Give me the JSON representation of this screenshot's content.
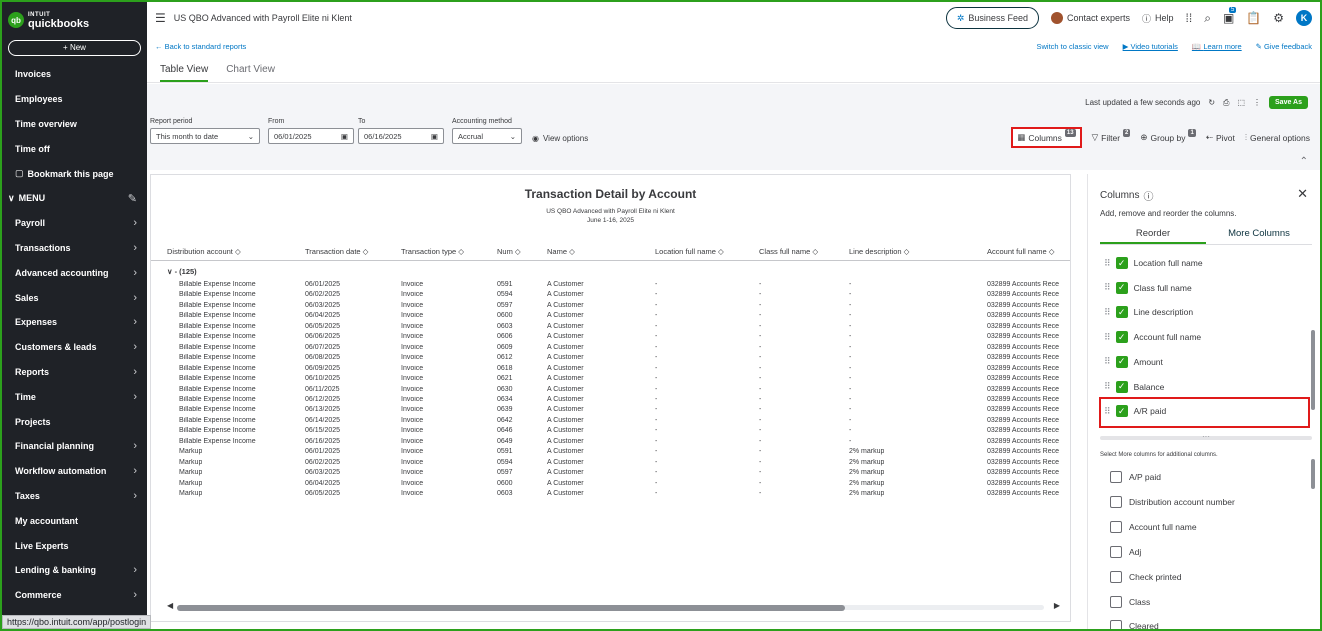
{
  "sidebar": {
    "logo_top": "INTUIT",
    "logo_bottom": "quickbooks",
    "logo_badge": "qb",
    "new_label": "+ New",
    "items": [
      {
        "label": "Invoices",
        "chevron": false
      },
      {
        "label": "Employees",
        "chevron": false
      },
      {
        "label": "Time overview",
        "chevron": false
      },
      {
        "label": "Time off",
        "chevron": false
      },
      {
        "label": "Bookmark this page",
        "chevron": false,
        "icon": "bookmark-icon"
      },
      {
        "label": "MENU",
        "chevron": false,
        "menu": true
      },
      {
        "label": "Payroll",
        "chevron": true
      },
      {
        "label": "Transactions",
        "chevron": true
      },
      {
        "label": "Advanced accounting",
        "chevron": true
      },
      {
        "label": "Sales",
        "chevron": true
      },
      {
        "label": "Expenses",
        "chevron": true
      },
      {
        "label": "Customers & leads",
        "chevron": true
      },
      {
        "label": "Reports",
        "chevron": true
      },
      {
        "label": "Time",
        "chevron": true
      },
      {
        "label": "Projects",
        "chevron": false
      },
      {
        "label": "Financial planning",
        "chevron": true
      },
      {
        "label": "Workflow automation",
        "chevron": true
      },
      {
        "label": "Taxes",
        "chevron": true
      },
      {
        "label": "My accountant",
        "chevron": false
      },
      {
        "label": "Live Experts",
        "chevron": false
      },
      {
        "label": "Lending & banking",
        "chevron": true
      },
      {
        "label": "Commerce",
        "chevron": true
      }
    ],
    "status_url": "https://qbo.intuit.com/app/postlogin"
  },
  "topbar": {
    "company": "US QBO Advanced with Payroll Elite ni Klent",
    "business_feed": "Business Feed",
    "contact_experts": "Contact experts",
    "help": "Help",
    "avatar_letter": "K",
    "notification_count": "5"
  },
  "subbar": {
    "back": "← Back to standard reports",
    "switch_classic": "Switch to classic view",
    "video_tutorials": "Video tutorials",
    "learn_more": "Learn more",
    "give_feedback": "Give feedback"
  },
  "tabs": [
    "Table View",
    "Chart View"
  ],
  "filters": {
    "last_updated": "Last updated a few seconds ago",
    "save_label": "Save As",
    "report_period_label": "Report period",
    "report_period_value": "This month to date",
    "from_label": "From",
    "from_value": "06/01/2025",
    "to_label": "To",
    "to_value": "06/16/2025",
    "method_label": "Accounting method",
    "method_value": "Accrual",
    "view_options": "View options",
    "columns_label": "Columns",
    "columns_count": "13",
    "filter_label": "Filter",
    "filter_count": "2",
    "groupby_label": "Group by",
    "groupby_count": "1",
    "pivot_label": "Pivot",
    "general_options": "General options"
  },
  "report": {
    "title": "Transaction Detail by Account",
    "subtitle": "US QBO Advanced with Payroll Elite ni Klent",
    "date_range": "June 1-16, 2025",
    "headers": [
      "Distribution account ◇",
      "Transaction date ◇",
      "Transaction type ◇",
      "Num ◇",
      "Name ◇",
      "Location full name ◇",
      "Class full name ◇",
      "Line description ◇",
      "Account full name ◇"
    ],
    "group_label": "∨  - (125)",
    "rows": [
      [
        "Billable Expense Income",
        "06/01/2025",
        "Invoice",
        "0591",
        "A Customer",
        "-",
        "-",
        "-",
        "032899 Accounts Rece"
      ],
      [
        "Billable Expense Income",
        "06/02/2025",
        "Invoice",
        "0594",
        "A Customer",
        "-",
        "-",
        "-",
        "032899 Accounts Rece"
      ],
      [
        "Billable Expense Income",
        "06/03/2025",
        "Invoice",
        "0597",
        "A Customer",
        "-",
        "-",
        "-",
        "032899 Accounts Rece"
      ],
      [
        "Billable Expense Income",
        "06/04/2025",
        "Invoice",
        "0600",
        "A Customer",
        "-",
        "-",
        "-",
        "032899 Accounts Rece"
      ],
      [
        "Billable Expense Income",
        "06/05/2025",
        "Invoice",
        "0603",
        "A Customer",
        "-",
        "-",
        "-",
        "032899 Accounts Rece"
      ],
      [
        "Billable Expense Income",
        "06/06/2025",
        "Invoice",
        "0606",
        "A Customer",
        "-",
        "-",
        "-",
        "032899 Accounts Rece"
      ],
      [
        "Billable Expense Income",
        "06/07/2025",
        "Invoice",
        "0609",
        "A Customer",
        "-",
        "-",
        "-",
        "032899 Accounts Rece"
      ],
      [
        "Billable Expense Income",
        "06/08/2025",
        "Invoice",
        "0612",
        "A Customer",
        "-",
        "-",
        "-",
        "032899 Accounts Rece"
      ],
      [
        "Billable Expense Income",
        "06/09/2025",
        "Invoice",
        "0618",
        "A Customer",
        "-",
        "-",
        "-",
        "032899 Accounts Rece"
      ],
      [
        "Billable Expense Income",
        "06/10/2025",
        "Invoice",
        "0621",
        "A Customer",
        "-",
        "-",
        "-",
        "032899 Accounts Rece"
      ],
      [
        "Billable Expense Income",
        "06/11/2025",
        "Invoice",
        "0630",
        "A Customer",
        "-",
        "-",
        "-",
        "032899 Accounts Rece"
      ],
      [
        "Billable Expense Income",
        "06/12/2025",
        "Invoice",
        "0634",
        "A Customer",
        "-",
        "-",
        "-",
        "032899 Accounts Rece"
      ],
      [
        "Billable Expense Income",
        "06/13/2025",
        "Invoice",
        "0639",
        "A Customer",
        "-",
        "-",
        "-",
        "032899 Accounts Rece"
      ],
      [
        "Billable Expense Income",
        "06/14/2025",
        "Invoice",
        "0642",
        "A Customer",
        "-",
        "-",
        "-",
        "032899 Accounts Rece"
      ],
      [
        "Billable Expense Income",
        "06/15/2025",
        "Invoice",
        "0646",
        "A Customer",
        "-",
        "-",
        "-",
        "032899 Accounts Rece"
      ],
      [
        "Billable Expense Income",
        "06/16/2025",
        "Invoice",
        "0649",
        "A Customer",
        "-",
        "-",
        "-",
        "032899 Accounts Rece"
      ],
      [
        "Markup",
        "06/01/2025",
        "Invoice",
        "0591",
        "A Customer",
        "-",
        "-",
        "2% markup",
        "032899 Accounts Rece"
      ],
      [
        "Markup",
        "06/02/2025",
        "Invoice",
        "0594",
        "A Customer",
        "-",
        "-",
        "2% markup",
        "032899 Accounts Rece"
      ],
      [
        "Markup",
        "06/03/2025",
        "Invoice",
        "0597",
        "A Customer",
        "-",
        "-",
        "2% markup",
        "032899 Accounts Rece"
      ],
      [
        "Markup",
        "06/04/2025",
        "Invoice",
        "0600",
        "A Customer",
        "-",
        "-",
        "2% markup",
        "032899 Accounts Rece"
      ],
      [
        "Markup",
        "06/05/2025",
        "Invoice",
        "0603",
        "A Customer",
        "-",
        "-",
        "2% markup",
        "032899 Accounts Rece"
      ]
    ]
  },
  "columns_panel": {
    "title": "Columns",
    "description": "Add, remove and reorder the columns.",
    "tab_reorder": "Reorder",
    "tab_more": "More Columns",
    "reorder_items": [
      "Location full name",
      "Class full name",
      "Line description",
      "Account full name",
      "Amount",
      "Balance",
      "A/R paid"
    ],
    "hint": "Select More columns for additional columns.",
    "more_items": [
      "A/P paid",
      "Distribution account number",
      "Account full name",
      "Adj",
      "Check printed",
      "Class",
      "Cleared"
    ]
  }
}
